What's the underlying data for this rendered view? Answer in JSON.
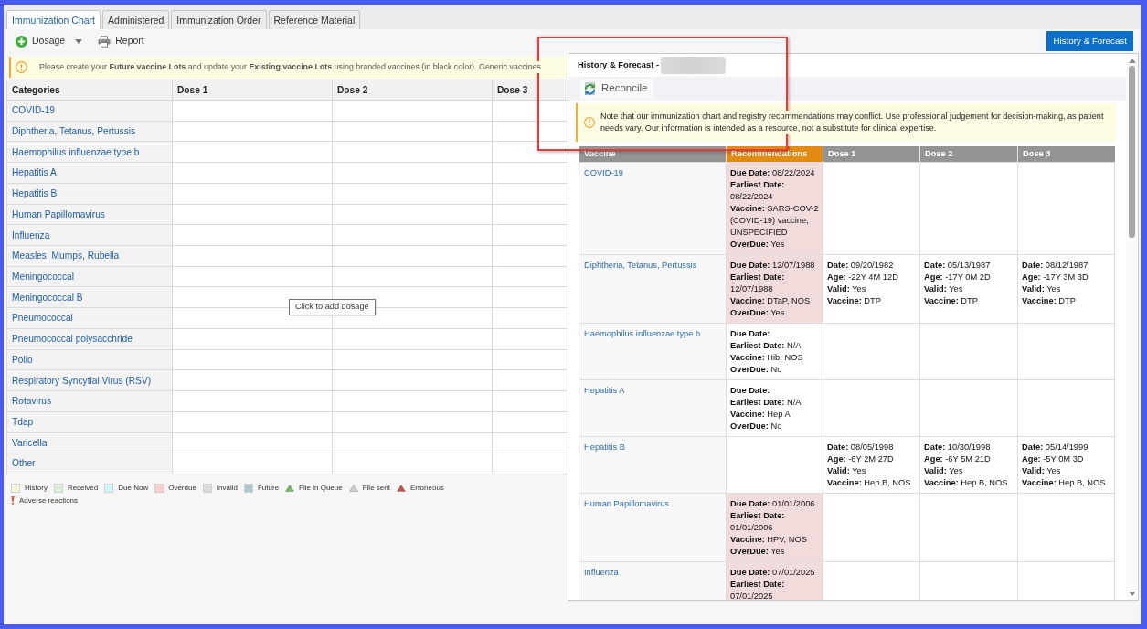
{
  "tabs": [
    {
      "label": "Immunization Chart",
      "selected": true
    },
    {
      "label": "Administered",
      "selected": false
    },
    {
      "label": "Immunization Order",
      "selected": false
    },
    {
      "label": "Reference Material",
      "selected": false
    }
  ],
  "toolbar": {
    "dosage_button": "Dosage",
    "report_button": "Report",
    "history_forecast_button": "History & Forecast"
  },
  "notice": "Please create your **Future vaccine Lots** and update your **Existing vaccine Lots** using branded vaccines (in black color). Generic vaccines",
  "chart_table": {
    "columns": [
      "Categories",
      "Dose 1",
      "Dose 2",
      "Dose 3"
    ],
    "categories": [
      "COVID-19",
      "Diphtheria, Tetanus, Pertussis",
      "Haemophilus influenzae type b",
      "Hepatitis A",
      "Hepatitis B",
      "Human Papillomavirus",
      "Influenza",
      "Measles, Mumps, Rubella",
      "Meningococcal",
      "Meningococcal B",
      "Pneumococcal",
      "Pneumococcal polysacchride",
      "Polio",
      "Respiratory Syncytial Virus (RSV)",
      "Rotavirus",
      "Tdap",
      "Varicella",
      "Other"
    ]
  },
  "tooltip": "Click to add dosage",
  "legend": {
    "rows": [
      [
        {
          "kind": "swatch",
          "color": "#f8f6dc",
          "label": "History"
        },
        {
          "kind": "swatch",
          "color": "#dbeedb",
          "label": "Received"
        },
        {
          "kind": "swatch",
          "color": "#cff6fc",
          "label": "Due Now"
        },
        {
          "kind": "swatch",
          "color": "#fbcfcf",
          "label": "Overdue"
        },
        {
          "kind": "swatch",
          "color": "#dcdcdc",
          "label": "Invalid"
        },
        {
          "kind": "swatch",
          "color": "#b2c7cb",
          "label": "Future"
        },
        {
          "kind": "triangle",
          "color": "#6cbf5b",
          "label": "File in Queue"
        },
        {
          "kind": "triangle",
          "color": "#d0d0d0",
          "label": "File sent"
        },
        {
          "kind": "triangle",
          "color": "#c9524f",
          "label": "Erroneous"
        }
      ],
      [
        {
          "kind": "marker",
          "color": "#e0572a",
          "label": "Adverse reactions"
        }
      ]
    ]
  },
  "history_panel": {
    "title": "History & Forecast -",
    "reconcile_button": "Reconcile",
    "note": "Note that our immunization chart and registry recommendations may conflict. Use professional judgement for decision-making, as patient needs vary. Our information is intended as a resource, not a substitute for clinical expertise.",
    "columns": [
      {
        "label": "Vaccine",
        "highlighted": false
      },
      {
        "label": "Recommendations",
        "highlighted": true
      },
      {
        "label": "Dose 1",
        "highlighted": false
      },
      {
        "label": "Dose 2",
        "highlighted": false
      },
      {
        "label": "Dose 3",
        "highlighted": false
      }
    ],
    "rows": [
      {
        "vaccine": "COVID-19",
        "recommendation": {
          "overdue": true,
          "fields": [
            {
              "label": "Due Date:",
              "value": "08/22/2024"
            },
            {
              "label": "Earliest Date:",
              "value": "08/22/2024"
            },
            {
              "label": "Vaccine:",
              "value": "SARS-COV-2 (COVID-19) vaccine, UNSPECIFIED"
            },
            {
              "label": "OverDue:",
              "value": "Yes"
            }
          ]
        }
      },
      {
        "vaccine": "Diphtheria, Tetanus, Pertussis",
        "recommendation": {
          "overdue": true,
          "fields": [
            {
              "label": "Due Date:",
              "value": "12/07/1988"
            },
            {
              "label": "Earliest Date:",
              "value": "12/07/1988"
            },
            {
              "label": "Vaccine:",
              "value": "DTaP, NOS"
            },
            {
              "label": "OverDue:",
              "value": "Yes"
            }
          ]
        },
        "doses": [
          {
            "fields": [
              {
                "label": "Date:",
                "value": "09/20/1982"
              },
              {
                "label": "Age:",
                "value": "-22Y 4M 12D"
              },
              {
                "label": "Valid:",
                "value": "Yes"
              },
              {
                "label": "Vaccine:",
                "value": "DTP"
              }
            ]
          },
          {
            "fields": [
              {
                "label": "Date:",
                "value": "05/13/1987"
              },
              {
                "label": "Age:",
                "value": "-17Y 0M 2D"
              },
              {
                "label": "Valid:",
                "value": "Yes"
              },
              {
                "label": "Vaccine:",
                "value": "DTP"
              }
            ]
          },
          {
            "fields": [
              {
                "label": "Date:",
                "value": "08/12/1987"
              },
              {
                "label": "Age:",
                "value": "-17Y 3M 3D"
              },
              {
                "label": "Valid:",
                "value": "Yes"
              },
              {
                "label": "Vaccine:",
                "value": "DTP"
              }
            ]
          }
        ]
      },
      {
        "vaccine": "Haemophilus influenzae type b",
        "recommendation": {
          "overdue": false,
          "fields": [
            {
              "label": "Due Date:"
            },
            {
              "label": "Earliest Date:",
              "value": "N/A"
            },
            {
              "label": "Vaccine:",
              "value": "Hib, NOS"
            },
            {
              "label": "OverDue:",
              "value": "No"
            }
          ]
        }
      },
      {
        "vaccine": "Hepatitis A",
        "recommendation": {
          "overdue": false,
          "fields": [
            {
              "label": "Due Date:"
            },
            {
              "label": "Earliest Date:",
              "value": "N/A"
            },
            {
              "label": "Vaccine:",
              "value": "Hep A"
            },
            {
              "label": "OverDue:",
              "value": "No"
            }
          ]
        }
      },
      {
        "vaccine": "Hepatitis B",
        "doses": [
          {
            "fields": [
              {
                "label": "Date:",
                "value": "08/05/1998"
              },
              {
                "label": "Age:",
                "value": "-6Y 2M 27D"
              },
              {
                "label": "Valid:",
                "value": "Yes"
              },
              {
                "label": "Vaccine:",
                "value": "Hep B, NOS"
              }
            ]
          },
          {
            "fields": [
              {
                "label": "Date:",
                "value": "10/30/1998"
              },
              {
                "label": "Age:",
                "value": "-6Y 5M 21D"
              },
              {
                "label": "Valid:",
                "value": "Yes"
              },
              {
                "label": "Vaccine:",
                "value": "Hep B, NOS"
              }
            ]
          },
          {
            "fields": [
              {
                "label": "Date:",
                "value": "05/14/1999"
              },
              {
                "label": "Age:",
                "value": "-5Y 0M 3D"
              },
              {
                "label": "Valid:",
                "value": "Yes"
              },
              {
                "label": "Vaccine:",
                "value": "Hep B, NOS"
              }
            ]
          }
        ]
      },
      {
        "vaccine": "Human Papillomavirus",
        "recommendation": {
          "overdue": true,
          "fields": [
            {
              "label": "Due Date:",
              "value": "01/01/2006"
            },
            {
              "label": "Earliest Date:",
              "value": "01/01/2006"
            },
            {
              "label": "Vaccine:",
              "value": "HPV, NOS"
            },
            {
              "label": "OverDue:",
              "value": "Yes"
            }
          ]
        }
      },
      {
        "vaccine": "Influenza",
        "recommendation": {
          "overdue": true,
          "fields": [
            {
              "label": "Due Date:",
              "value": "07/01/2025"
            },
            {
              "label": "Earliest Date:",
              "value": "07/01/2025"
            }
          ]
        }
      }
    ]
  }
}
